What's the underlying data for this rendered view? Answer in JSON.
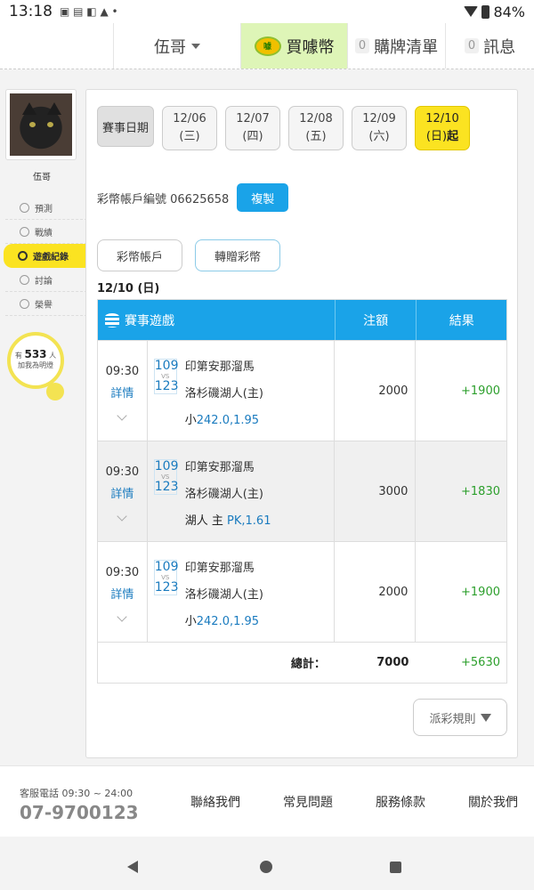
{
  "status": {
    "time": "13:18",
    "battery": "84%"
  },
  "topnav": {
    "user": "伍哥",
    "buy": "買噱幣",
    "cart_count": "0",
    "cart": "購牌清單",
    "msg_count": "0",
    "msg": "訊息"
  },
  "sidebar": {
    "name": "伍哥",
    "items": [
      {
        "label": "預測",
        "active": false
      },
      {
        "label": "戰績",
        "active": false
      },
      {
        "label": "遊戲紀錄",
        "active": true
      },
      {
        "label": "討論",
        "active": false
      },
      {
        "label": "榮譽",
        "active": false
      }
    ],
    "bulb": {
      "prefix": "有",
      "count": "533",
      "suffix": "人",
      "line2": "加我為明燈"
    }
  },
  "dates": {
    "label": "賽事日期",
    "items": [
      {
        "date": "12/06",
        "day": "(三)"
      },
      {
        "date": "12/07",
        "day": "(四)"
      },
      {
        "date": "12/08",
        "day": "(五)"
      },
      {
        "date": "12/09",
        "day": "(六)"
      },
      {
        "date": "12/10",
        "day": "(日)",
        "suffix": "起"
      }
    ]
  },
  "account": {
    "label": "彩幣帳戶編號 06625658",
    "copy": "複製"
  },
  "tabs": [
    "彩幣帳戶",
    "轉贈彩幣"
  ],
  "day_title": "12/10 (日)",
  "table": {
    "headers": [
      "賽事遊戲",
      "注額",
      "結果"
    ],
    "rows": [
      {
        "time": "09:30",
        "detail": "詳情",
        "away_no": "109",
        "home_no": "123",
        "away": "印第安那溜馬",
        "home": "洛杉磯湖人(主)",
        "bet_label": "小",
        "bet_odd": "242.0,",
        "bet_price": "1.95",
        "amount": "2000",
        "result": "+1900"
      },
      {
        "time": "09:30",
        "detail": "詳情",
        "away_no": "109",
        "home_no": "123",
        "away": "印第安那溜馬",
        "home": "洛杉磯湖人(主)",
        "bet_label": "湖人 主",
        "bet_odd": "PK,",
        "bet_price": "1.61",
        "amount": "3000",
        "result": "+1830"
      },
      {
        "time": "09:30",
        "detail": "詳情",
        "away_no": "109",
        "home_no": "123",
        "away": "印第安那溜馬",
        "home": "洛杉磯湖人(主)",
        "bet_label": "小",
        "bet_odd": "242.0,",
        "bet_price": "1.95",
        "amount": "2000",
        "result": "+1900"
      }
    ],
    "vs": "VS",
    "total_label": "總計：",
    "total_amount": "7000",
    "total_result": "+5630"
  },
  "rules": "派彩規則",
  "footer": {
    "hotline_label": "客服電話 09:30 ~ 24:00",
    "hotline": "07-9700123",
    "links": [
      "聯絡我們",
      "常見問題",
      "服務條款",
      "關於我們"
    ]
  }
}
